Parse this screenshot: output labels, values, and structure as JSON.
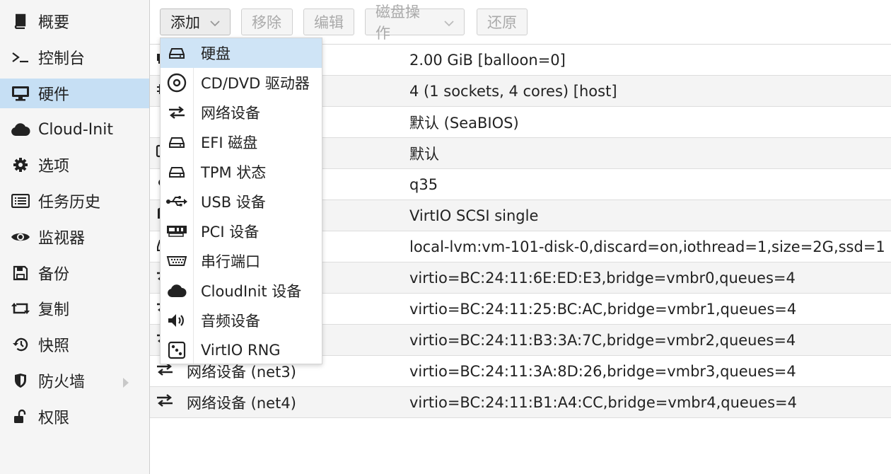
{
  "sidebar": {
    "items": [
      {
        "label": "概要",
        "icon": "book-icon"
      },
      {
        "label": "控制台",
        "icon": "terminal-icon"
      },
      {
        "label": "硬件",
        "icon": "monitor-icon",
        "active": true
      },
      {
        "label": "Cloud-Init",
        "icon": "cloud-icon"
      },
      {
        "label": "选项",
        "icon": "gear-icon"
      },
      {
        "label": "任务历史",
        "icon": "list-icon"
      },
      {
        "label": "监视器",
        "icon": "eye-icon"
      },
      {
        "label": "备份",
        "icon": "floppy-icon"
      },
      {
        "label": "复制",
        "icon": "retweet-icon"
      },
      {
        "label": "快照",
        "icon": "history-icon"
      },
      {
        "label": "防火墙",
        "icon": "shield-icon"
      },
      {
        "label": "权限",
        "icon": "unlock-icon"
      }
    ]
  },
  "toolbar": {
    "add": "添加",
    "remove": "移除",
    "edit": "编辑",
    "disk_action": "磁盘操作",
    "revert": "还原"
  },
  "add_menu": {
    "items": [
      {
        "label": "硬盘",
        "icon": "hdd-icon"
      },
      {
        "label": "CD/DVD 驱动器",
        "icon": "cdrom-icon"
      },
      {
        "label": "网络设备",
        "icon": "exchange-icon"
      },
      {
        "label": "EFI 磁盘",
        "icon": "hdd-icon"
      },
      {
        "label": "TPM 状态",
        "icon": "hdd-icon"
      },
      {
        "label": "USB 设备",
        "icon": "usb-icon"
      },
      {
        "label": "PCI 设备",
        "icon": "pci-card-icon"
      },
      {
        "label": "串行端口",
        "icon": "serial-port-icon"
      },
      {
        "label": "CloudInit 设备",
        "icon": "cloud-icon"
      },
      {
        "label": "音频设备",
        "icon": "volume-icon"
      },
      {
        "label": "VirtIO RNG",
        "icon": "dice-icon"
      }
    ]
  },
  "hardware": {
    "rows": [
      {
        "name": "",
        "value": "2.00 GiB [balloon=0]"
      },
      {
        "name": "",
        "value": "4 (1 sockets, 4 cores) [host]"
      },
      {
        "name": "",
        "value": "默认 (SeaBIOS)"
      },
      {
        "name": "",
        "value": "默认"
      },
      {
        "name": "",
        "value": "q35"
      },
      {
        "name": "",
        "value": "VirtIO SCSI single"
      },
      {
        "name": "",
        "value": "local-lvm:vm-101-disk-0,discard=on,iothread=1,size=2G,ssd=1"
      },
      {
        "name": "",
        "value": "virtio=BC:24:11:6E:ED:E3,bridge=vmbr0,queues=4"
      },
      {
        "name": "",
        "value": "virtio=BC:24:11:25:BC:AC,bridge=vmbr1,queues=4"
      },
      {
        "name": "",
        "value": "virtio=BC:24:11:B3:3A:7C,bridge=vmbr2,queues=4"
      },
      {
        "name": "网络设备 (net3)",
        "value": "virtio=BC:24:11:3A:8D:26,bridge=vmbr3,queues=4"
      },
      {
        "name": "网络设备 (net4)",
        "value": "virtio=BC:24:11:B1:A4:CC,bridge=vmbr4,queues=4"
      }
    ]
  }
}
